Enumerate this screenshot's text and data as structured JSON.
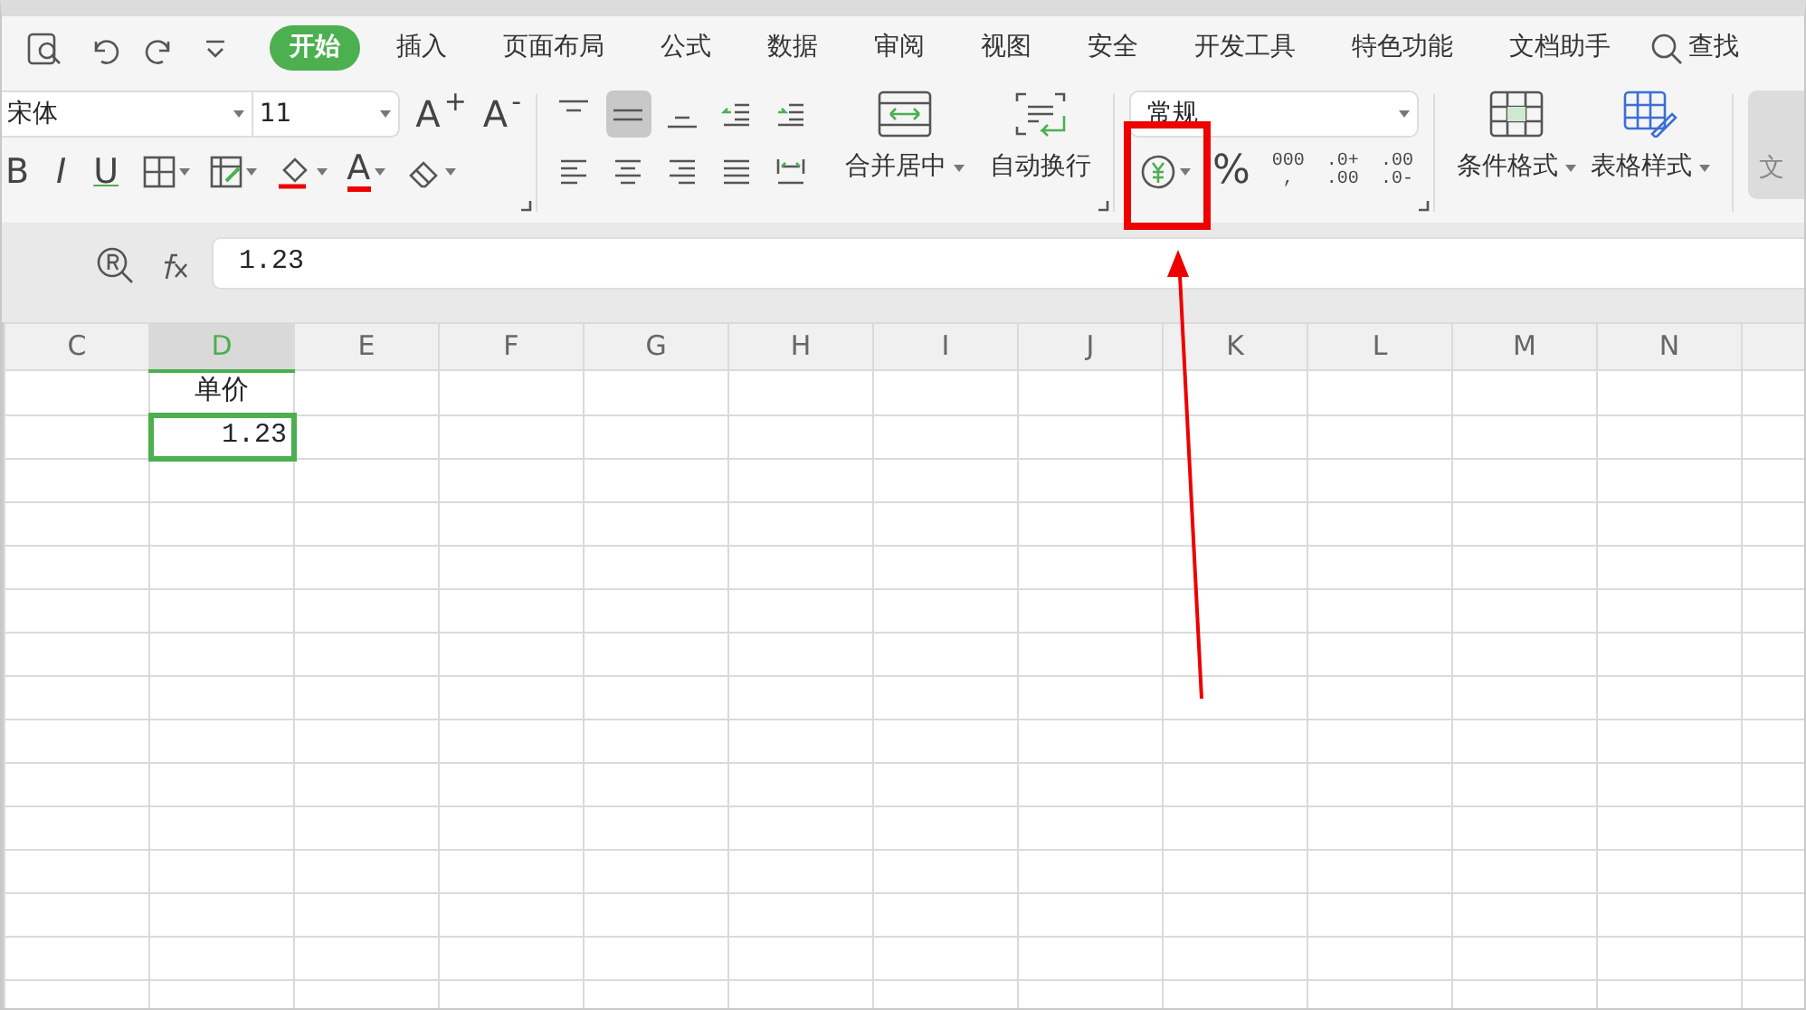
{
  "tabs": [
    {
      "label": "开始",
      "selected": true
    },
    {
      "label": "插入",
      "selected": false
    },
    {
      "label": "页面布局",
      "selected": false
    },
    {
      "label": "公式",
      "selected": false
    },
    {
      "label": "数据",
      "selected": false
    },
    {
      "label": "审阅",
      "selected": false
    },
    {
      "label": "视图",
      "selected": false
    },
    {
      "label": "安全",
      "selected": false
    },
    {
      "label": "开发工具",
      "selected": false
    },
    {
      "label": "特色功能",
      "selected": false
    },
    {
      "label": "文档助手",
      "selected": false
    }
  ],
  "search": {
    "label": "查找"
  },
  "font": {
    "name": "宋体",
    "size": "11",
    "grow_label": "A$^{+}$",
    "shrink_label": "A$^{-}$",
    "style_buttons": [
      "B",
      "I",
      "U"
    ],
    "font_color_label": "A"
  },
  "alignment": {
    "top_row": [
      {
        "selected": false
      },
      {
        "selected": true
      },
      {
        "selected": false
      },
      {
        "selected": false
      },
      {
        "selected": false
      }
    ],
    "bottom_row": [
      {
        "selected": false
      },
      {
        "selected": false
      },
      {
        "selected": false
      },
      {
        "selected": false
      },
      {
        "selected": false
      }
    ]
  },
  "merge_buttons": [
    {
      "label": "合并居中",
      "dropdown": true
    },
    {
      "label": "自动换行",
      "dropdown": false
    }
  ],
  "number_format": {
    "value": "常规",
    "buttons": [
      {
        "lines": [
          "%"
        ]
      },
      {
        "lines": [
          "000",
          ","
        ]
      },
      {
        "lines": [
          ".0+",
          ".00"
        ]
      },
      {
        "lines": [
          ".00",
          ".0-"
        ]
      }
    ]
  },
  "style_buttons": [
    {
      "label": "条件格式",
      "dropdown": true
    },
    {
      "label": "表格样式",
      "dropdown": true
    }
  ],
  "cut_button": {
    "label": "文"
  },
  "formula_bar": {
    "value": "1.23"
  },
  "sheet": {
    "columns": [
      {
        "label": "C",
        "selected": false
      },
      {
        "label": "D",
        "selected": true,
        "cells": [
          {
            "text": "单价",
            "kind": "text",
            "selected": false
          },
          {
            "text": "1.23",
            "kind": "number",
            "selected": true
          }
        ]
      },
      {
        "label": "E",
        "selected": false
      },
      {
        "label": "F",
        "selected": false
      },
      {
        "label": "G",
        "selected": false
      },
      {
        "label": "H",
        "selected": false
      },
      {
        "label": "I",
        "selected": false
      },
      {
        "label": "J",
        "selected": false
      },
      {
        "label": "K",
        "selected": false
      },
      {
        "label": "L",
        "selected": false
      },
      {
        "label": "M",
        "selected": false
      },
      {
        "label": "N",
        "selected": false
      }
    ]
  }
}
